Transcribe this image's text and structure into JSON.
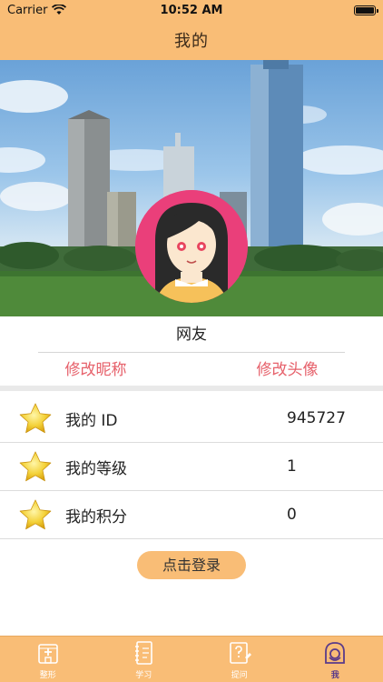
{
  "status_bar": {
    "carrier": "Carrier",
    "time": "10:52 AM"
  },
  "nav": {
    "title": "我的"
  },
  "profile": {
    "nickname": "网友",
    "edit_nickname": "修改昵称",
    "edit_avatar": "修改头像"
  },
  "info": [
    {
      "label": "我的 ID",
      "value": "945727",
      "icon": "star-icon"
    },
    {
      "label": "我的等级",
      "value": "1",
      "icon": "star-icon"
    },
    {
      "label": "我的积分",
      "value": "0",
      "icon": "star-icon"
    }
  ],
  "login_button": "点击登录",
  "tabs": [
    {
      "label": "整形",
      "icon": "hospital-icon",
      "active": false
    },
    {
      "label": "学习",
      "icon": "notebook-icon",
      "active": false
    },
    {
      "label": "提问",
      "icon": "question-icon",
      "active": false
    },
    {
      "label": "我",
      "icon": "profile-icon",
      "active": true
    }
  ],
  "colors": {
    "accent": "#f9bd76",
    "link": "#e6606a",
    "avatar_bg": "#ea3f7a",
    "tab_active": "#5a3b8a"
  }
}
